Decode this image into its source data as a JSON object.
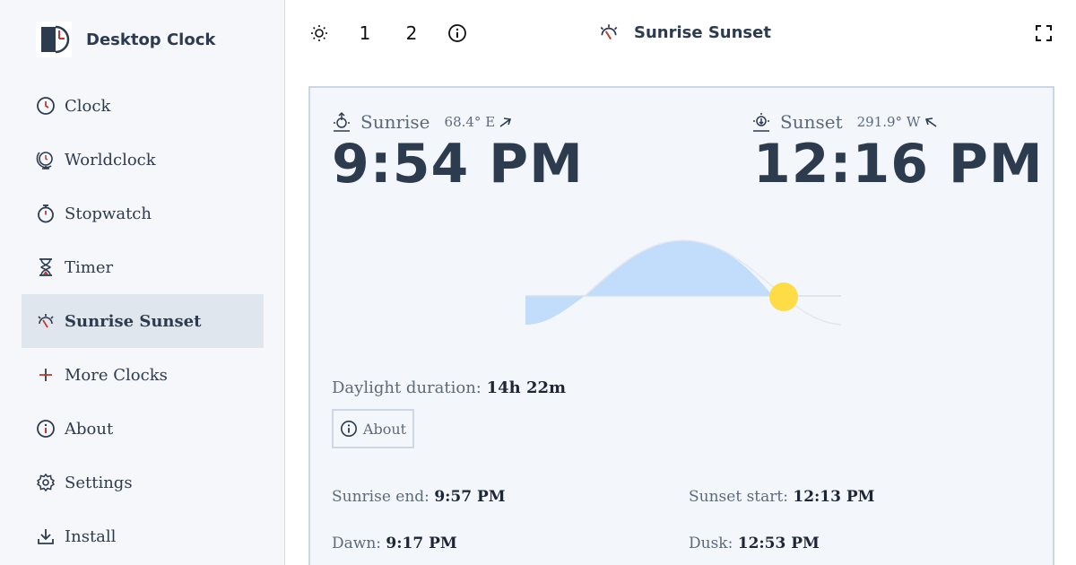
{
  "app": {
    "name": "Desktop Clock"
  },
  "sidebar": {
    "items": [
      {
        "label": "Clock",
        "icon": "clock-icon"
      },
      {
        "label": "Worldclock",
        "icon": "globe-clock-icon"
      },
      {
        "label": "Stopwatch",
        "icon": "stopwatch-icon"
      },
      {
        "label": "Timer",
        "icon": "hourglass-icon"
      },
      {
        "label": "Sunrise Sunset",
        "icon": "sunrise-sunset-icon",
        "active": true
      },
      {
        "label": "More Clocks",
        "icon": "plus-icon"
      },
      {
        "label": "About",
        "icon": "info-icon"
      },
      {
        "label": "Settings",
        "icon": "gear-icon"
      },
      {
        "label": "Install",
        "icon": "download-icon"
      }
    ]
  },
  "topbar": {
    "theme_icon": "sun-icon",
    "layout_1": "1",
    "layout_2": "2",
    "info_icon": "info-icon",
    "title": "Sunrise Sunset",
    "fullscreen_icon": "fullscreen-icon"
  },
  "sunrise": {
    "label": "Sunrise",
    "bearing": "68.4° E",
    "time": "9:54 PM"
  },
  "sunset": {
    "label": "Sunset",
    "bearing": "291.9° W",
    "time": "12:16 PM"
  },
  "daylight": {
    "label": "Daylight duration:",
    "value": "14h 22m"
  },
  "about_button": {
    "label": "About"
  },
  "details": {
    "sunrise_end_label": "Sunrise end:",
    "sunrise_end_value": "9:57 PM",
    "sunset_start_label": "Sunset start:",
    "sunset_start_value": "12:13 PM",
    "dawn_label": "Dawn:",
    "dawn_value": "9:17 PM",
    "dusk_label": "Dusk:",
    "dusk_value": "12:53 PM"
  },
  "colors": {
    "daylight_fill": "#c2dcfb",
    "sun": "#fddc45",
    "text_dark": "#2d3b4f",
    "active_bg": "#e0e6ee"
  }
}
